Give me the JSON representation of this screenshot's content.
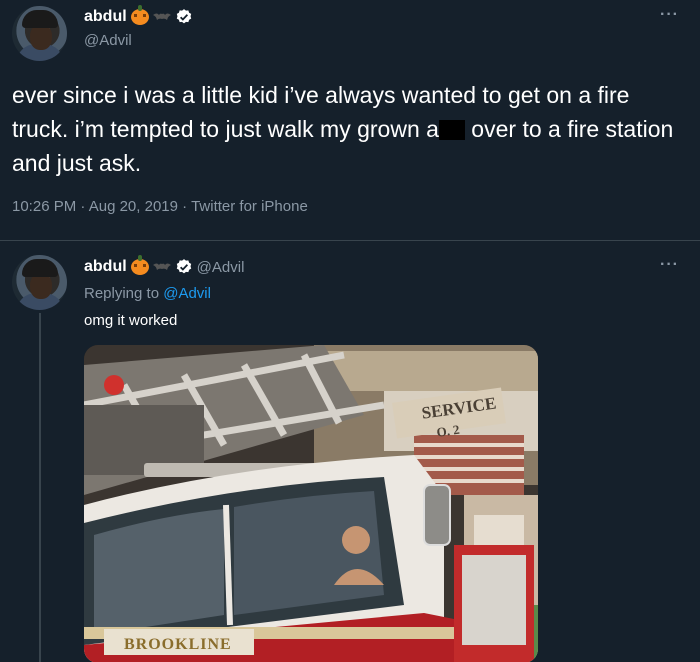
{
  "main_tweet": {
    "display_name": "abdul",
    "handle": "@Advil",
    "text_part1": "ever since i was a little kid i’ve always wanted to get on a fire truck. i’m tempted to just walk my grown a",
    "text_part2": " over to a fire station and just ask.",
    "time": "10:26 PM",
    "date": "Aug 20, 2019",
    "source": "Twitter for iPhone",
    "more_label": "···"
  },
  "reply_tweet": {
    "display_name": "abdul",
    "handle": "@Advil",
    "replying_prefix": "Replying to ",
    "replying_handle": "@Advil",
    "text": "omg it worked",
    "more_label": "···",
    "photo_sign_line1": "SERVICE",
    "photo_sign_line2": "O. 2",
    "photo_truck_lettering": "BROOKLINE"
  },
  "colors": {
    "background": "#15202b",
    "secondary_text": "#8b98a5",
    "link": "#1d9bf0",
    "verified": "#ffffff",
    "divider": "#38444d"
  },
  "icons": [
    "avatar",
    "pumpkin-emoji-icon",
    "bat-emoji-icon",
    "verified-badge-icon",
    "more-options-icon"
  ]
}
